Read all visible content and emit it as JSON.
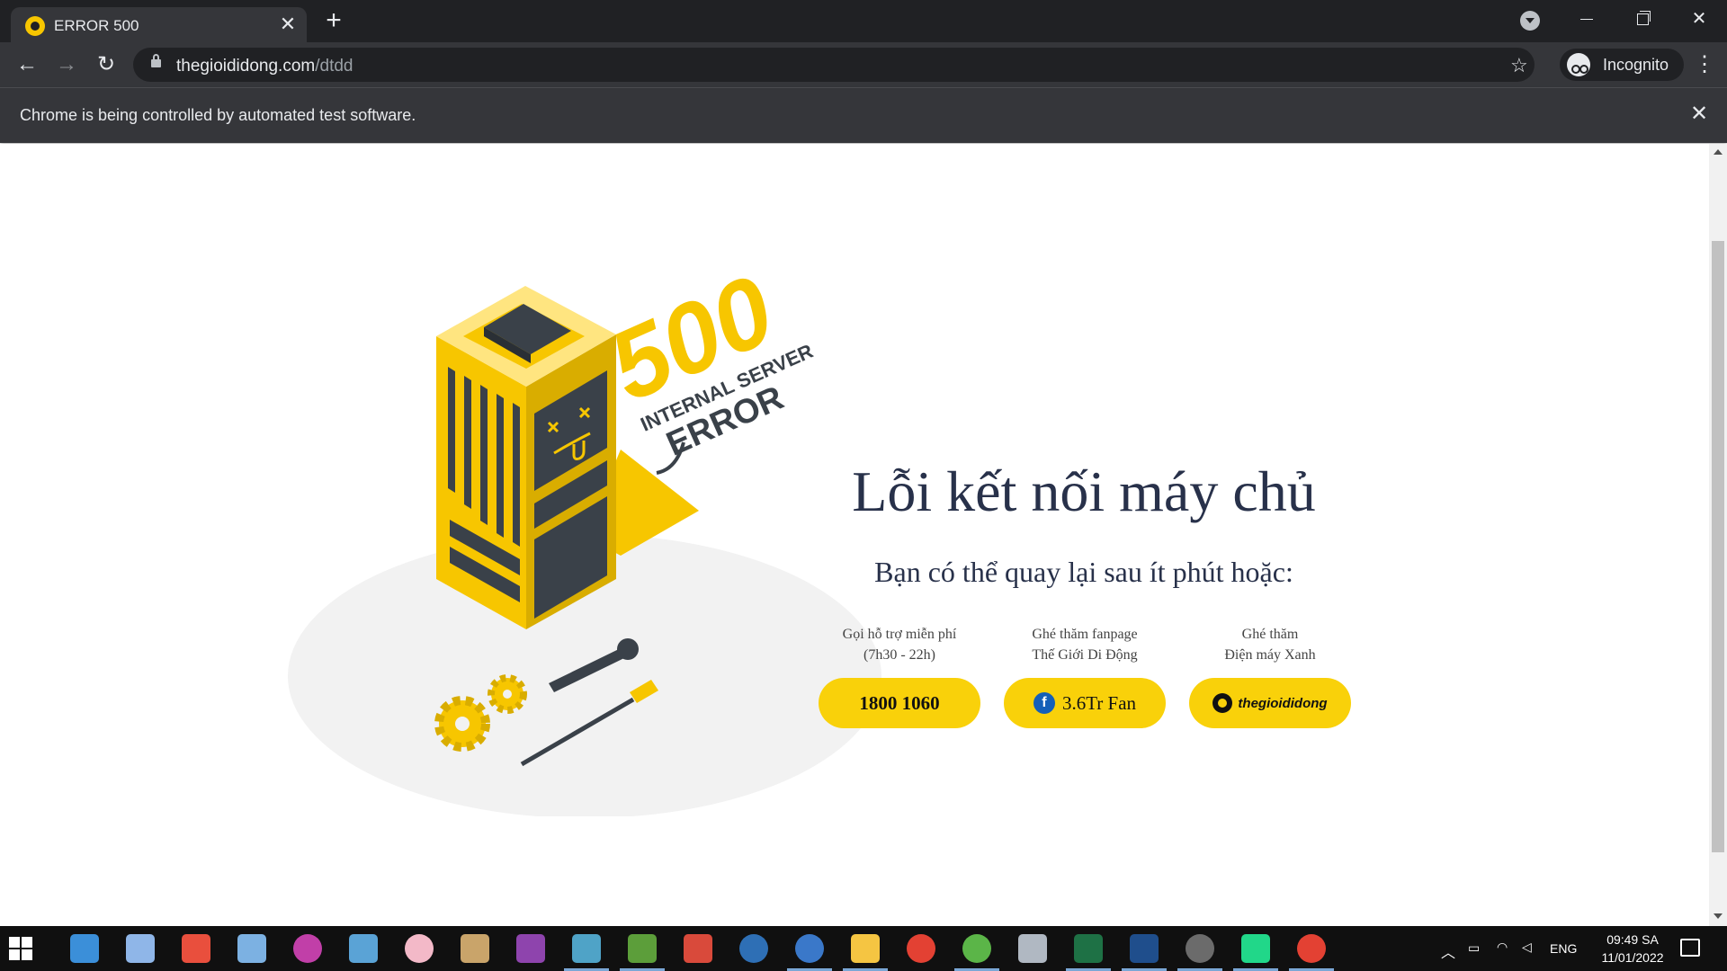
{
  "browser": {
    "tab_title": "ERROR 500",
    "tab_close": "✕",
    "new_tab": "+",
    "url_host": "thegioididong.com",
    "url_path": "/dtdd",
    "profile_label": "Incognito",
    "infobar_text": "Chrome is being controlled by automated test software.",
    "infobar_close": "✕"
  },
  "illustration": {
    "code": "500",
    "line1": "INTERNAL SERVER",
    "line2": "ERROR",
    "colors": {
      "yellow": "#f7c600",
      "dark": "#3a4149",
      "floor": "#f2f2f2"
    }
  },
  "page": {
    "heading": "Lỗi kết nối máy chủ",
    "subheading": "Bạn có thể quay lại sau ít phút hoặc:",
    "options": [
      {
        "label_line1": "Gọi hỗ trợ miễn phí",
        "label_line2": "(7h30 - 22h)",
        "button": "1800 1060"
      },
      {
        "label_line1": "Ghé thăm fanpage",
        "label_line2": "Thế Giới Di Động",
        "button": "3.6Tr Fan",
        "icon_letter": "f"
      },
      {
        "label_line1": "Ghé thăm",
        "label_line2": "Điện máy Xanh",
        "button": "thegioididong"
      }
    ],
    "accent": "#f9d10a",
    "text_color": "#28314a"
  },
  "taskbar": {
    "language": "ENG",
    "time": "09:49 SA",
    "date": "11/01/2022"
  }
}
